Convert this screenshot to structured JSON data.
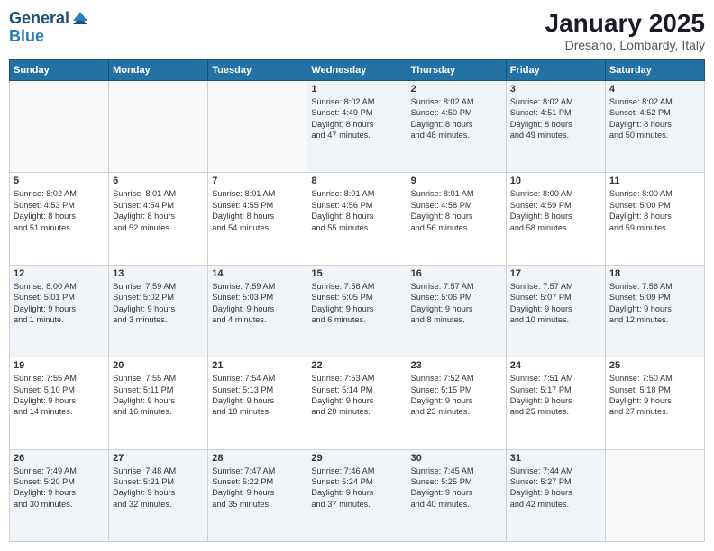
{
  "header": {
    "logo_line1": "General",
    "logo_line2": "Blue",
    "month": "January 2025",
    "location": "Dresano, Lombardy, Italy"
  },
  "weekdays": [
    "Sunday",
    "Monday",
    "Tuesday",
    "Wednesday",
    "Thursday",
    "Friday",
    "Saturday"
  ],
  "weeks": [
    [
      {
        "day": "",
        "info": ""
      },
      {
        "day": "",
        "info": ""
      },
      {
        "day": "",
        "info": ""
      },
      {
        "day": "1",
        "info": "Sunrise: 8:02 AM\nSunset: 4:49 PM\nDaylight: 8 hours\nand 47 minutes."
      },
      {
        "day": "2",
        "info": "Sunrise: 8:02 AM\nSunset: 4:50 PM\nDaylight: 8 hours\nand 48 minutes."
      },
      {
        "day": "3",
        "info": "Sunrise: 8:02 AM\nSunset: 4:51 PM\nDaylight: 8 hours\nand 49 minutes."
      },
      {
        "day": "4",
        "info": "Sunrise: 8:02 AM\nSunset: 4:52 PM\nDaylight: 8 hours\nand 50 minutes."
      }
    ],
    [
      {
        "day": "5",
        "info": "Sunrise: 8:02 AM\nSunset: 4:53 PM\nDaylight: 8 hours\nand 51 minutes."
      },
      {
        "day": "6",
        "info": "Sunrise: 8:01 AM\nSunset: 4:54 PM\nDaylight: 8 hours\nand 52 minutes."
      },
      {
        "day": "7",
        "info": "Sunrise: 8:01 AM\nSunset: 4:55 PM\nDaylight: 8 hours\nand 54 minutes."
      },
      {
        "day": "8",
        "info": "Sunrise: 8:01 AM\nSunset: 4:56 PM\nDaylight: 8 hours\nand 55 minutes."
      },
      {
        "day": "9",
        "info": "Sunrise: 8:01 AM\nSunset: 4:58 PM\nDaylight: 8 hours\nand 56 minutes."
      },
      {
        "day": "10",
        "info": "Sunrise: 8:00 AM\nSunset: 4:59 PM\nDaylight: 8 hours\nand 58 minutes."
      },
      {
        "day": "11",
        "info": "Sunrise: 8:00 AM\nSunset: 5:00 PM\nDaylight: 8 hours\nand 59 minutes."
      }
    ],
    [
      {
        "day": "12",
        "info": "Sunrise: 8:00 AM\nSunset: 5:01 PM\nDaylight: 9 hours\nand 1 minute."
      },
      {
        "day": "13",
        "info": "Sunrise: 7:59 AM\nSunset: 5:02 PM\nDaylight: 9 hours\nand 3 minutes."
      },
      {
        "day": "14",
        "info": "Sunrise: 7:59 AM\nSunset: 5:03 PM\nDaylight: 9 hours\nand 4 minutes."
      },
      {
        "day": "15",
        "info": "Sunrise: 7:58 AM\nSunset: 5:05 PM\nDaylight: 9 hours\nand 6 minutes."
      },
      {
        "day": "16",
        "info": "Sunrise: 7:57 AM\nSunset: 5:06 PM\nDaylight: 9 hours\nand 8 minutes."
      },
      {
        "day": "17",
        "info": "Sunrise: 7:57 AM\nSunset: 5:07 PM\nDaylight: 9 hours\nand 10 minutes."
      },
      {
        "day": "18",
        "info": "Sunrise: 7:56 AM\nSunset: 5:09 PM\nDaylight: 9 hours\nand 12 minutes."
      }
    ],
    [
      {
        "day": "19",
        "info": "Sunrise: 7:55 AM\nSunset: 5:10 PM\nDaylight: 9 hours\nand 14 minutes."
      },
      {
        "day": "20",
        "info": "Sunrise: 7:55 AM\nSunset: 5:11 PM\nDaylight: 9 hours\nand 16 minutes."
      },
      {
        "day": "21",
        "info": "Sunrise: 7:54 AM\nSunset: 5:13 PM\nDaylight: 9 hours\nand 18 minutes."
      },
      {
        "day": "22",
        "info": "Sunrise: 7:53 AM\nSunset: 5:14 PM\nDaylight: 9 hours\nand 20 minutes."
      },
      {
        "day": "23",
        "info": "Sunrise: 7:52 AM\nSunset: 5:15 PM\nDaylight: 9 hours\nand 23 minutes."
      },
      {
        "day": "24",
        "info": "Sunrise: 7:51 AM\nSunset: 5:17 PM\nDaylight: 9 hours\nand 25 minutes."
      },
      {
        "day": "25",
        "info": "Sunrise: 7:50 AM\nSunset: 5:18 PM\nDaylight: 9 hours\nand 27 minutes."
      }
    ],
    [
      {
        "day": "26",
        "info": "Sunrise: 7:49 AM\nSunset: 5:20 PM\nDaylight: 9 hours\nand 30 minutes."
      },
      {
        "day": "27",
        "info": "Sunrise: 7:48 AM\nSunset: 5:21 PM\nDaylight: 9 hours\nand 32 minutes."
      },
      {
        "day": "28",
        "info": "Sunrise: 7:47 AM\nSunset: 5:22 PM\nDaylight: 9 hours\nand 35 minutes."
      },
      {
        "day": "29",
        "info": "Sunrise: 7:46 AM\nSunset: 5:24 PM\nDaylight: 9 hours\nand 37 minutes."
      },
      {
        "day": "30",
        "info": "Sunrise: 7:45 AM\nSunset: 5:25 PM\nDaylight: 9 hours\nand 40 minutes."
      },
      {
        "day": "31",
        "info": "Sunrise: 7:44 AM\nSunset: 5:27 PM\nDaylight: 9 hours\nand 42 minutes."
      },
      {
        "day": "",
        "info": ""
      }
    ]
  ]
}
